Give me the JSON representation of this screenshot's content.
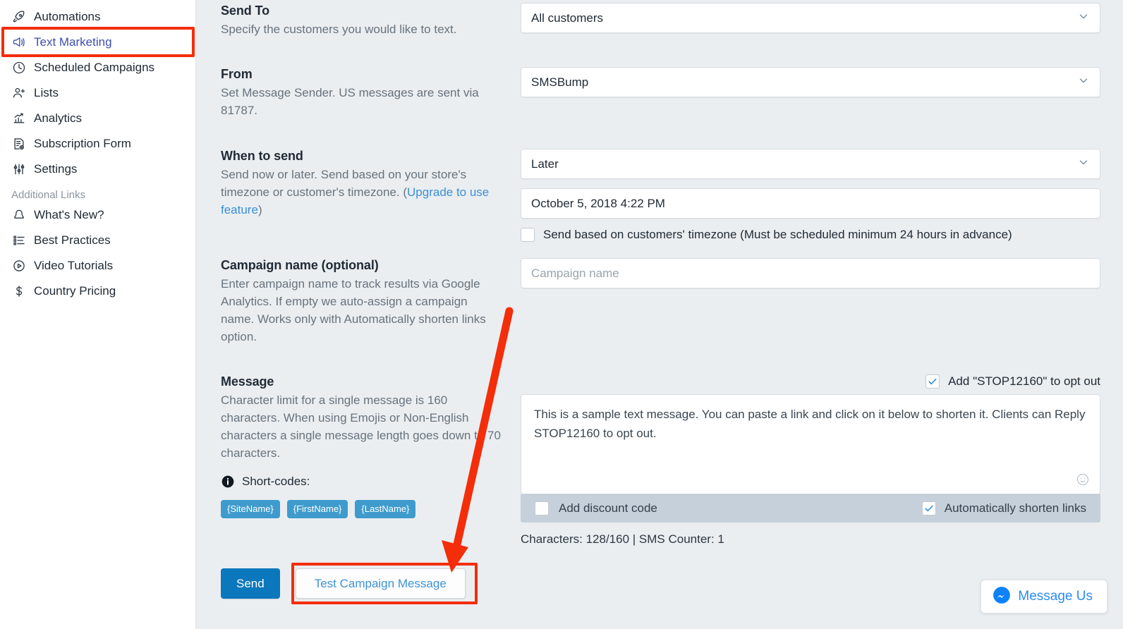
{
  "sidebar": {
    "items": [
      {
        "label": "Automations",
        "icon": "rocket-icon"
      },
      {
        "label": "Text Marketing",
        "icon": "megaphone-icon",
        "active": true
      },
      {
        "label": "Scheduled Campaigns",
        "icon": "clock-icon"
      },
      {
        "label": "Lists",
        "icon": "person-add-icon"
      },
      {
        "label": "Analytics",
        "icon": "bar-chart-icon"
      },
      {
        "label": "Subscription Form",
        "icon": "form-icon"
      },
      {
        "label": "Settings",
        "icon": "sliders-icon"
      }
    ],
    "additional_label": "Additional Links",
    "additional_items": [
      {
        "label": "What's New?",
        "icon": "bell-icon"
      },
      {
        "label": "Best Practices",
        "icon": "list-icon"
      },
      {
        "label": "Video Tutorials",
        "icon": "play-circle-icon"
      },
      {
        "label": "Country Pricing",
        "icon": "dollar-icon"
      }
    ],
    "highlight_color": "#f42d0a",
    "active_color": "#3f4eae"
  },
  "form": {
    "send_to": {
      "title": "Send To",
      "desc": "Specify the customers you would like to text.",
      "value": "All customers"
    },
    "from": {
      "title": "From",
      "desc": "Set Message Sender. US messages are sent via 81787.",
      "value": "SMSBump"
    },
    "when_to_send": {
      "title": "When to send",
      "desc_before": "Send now or later. Send based on your store's timezone or customer's timezone. (",
      "link": "Upgrade to use feature",
      "desc_after": ")",
      "value": "Later",
      "datetime": "October 5, 2018 4:22 PM",
      "timezone_checkbox_label": "Send based on customers' timezone (Must be scheduled minimum 24 hours in advance)",
      "timezone_checked": false
    },
    "campaign_name": {
      "title": "Campaign name (optional)",
      "desc": "Enter campaign name to track results via Google Analytics. If empty we auto-assign a campaign name. Works only with Automatically shorten links option.",
      "placeholder": "Campaign name",
      "value": ""
    },
    "message": {
      "title": "Message",
      "desc": "Character limit for a single message is 160 characters. When using Emojis or Non-English characters a single message length goes down to 70 characters.",
      "shortcodes_label": "Short-codes:",
      "shortcodes": [
        "{SiteName}",
        "{FirstName}",
        "{LastName}"
      ],
      "shortcode_color": "#3f9bcd",
      "optout_label": "Add \"STOP12160\" to opt out",
      "optout_checked": true,
      "body": "This is a sample text message. You can paste a link and click on it below to shorten it. Clients can Reply STOP12160 to opt out.",
      "discount_label": "Add discount code",
      "discount_checked": false,
      "shorten_label": "Automatically shorten links",
      "shorten_checked": true,
      "counter": "Characters: 128/160 | SMS Counter: 1"
    }
  },
  "actions": {
    "send_label": "Send",
    "test_label": "Test Campaign Message",
    "send_color": "#0b77bd",
    "test_color": "#3d93d8"
  },
  "messenger": {
    "label": "Message Us",
    "color": "#2b8cf0"
  }
}
